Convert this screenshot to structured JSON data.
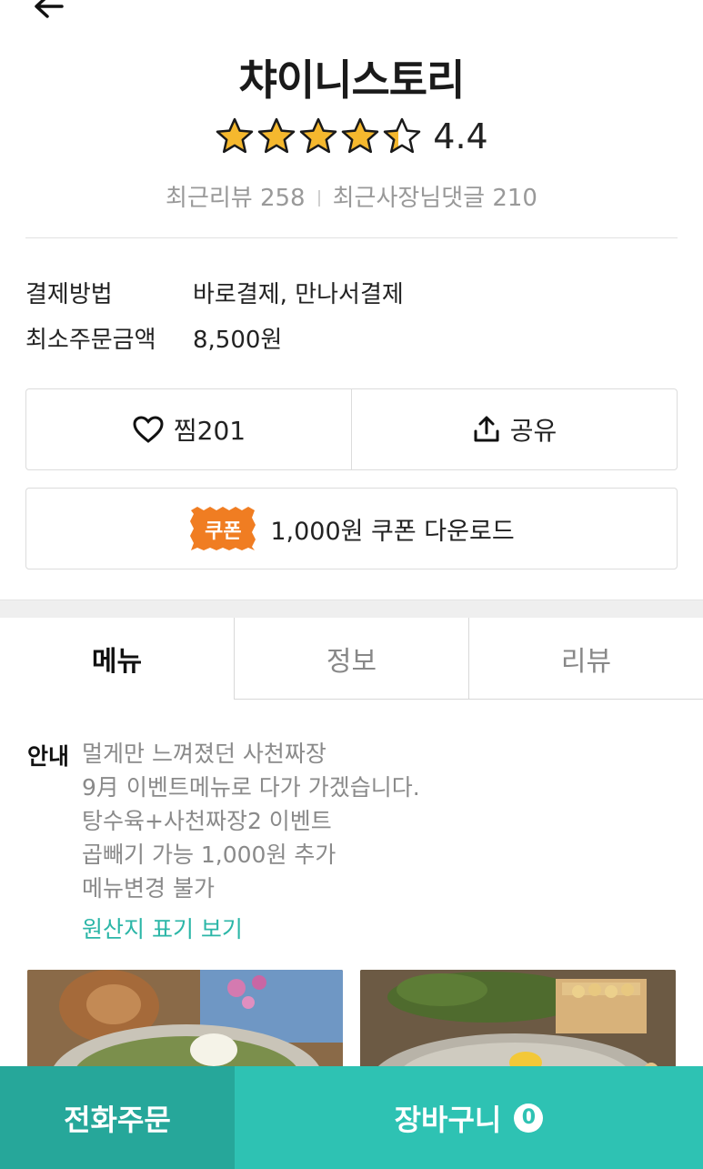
{
  "header": {
    "store_name": "챠이니스토리",
    "rating": "4.4",
    "stars_filled": 4.4,
    "review_label": "최근리뷰 258",
    "owner_reply_label": "최근사장님댓글 210"
  },
  "info": {
    "payment_key": "결제방법",
    "payment_value": "바로결제, 만나서결제",
    "min_order_key": "최소주문금액",
    "min_order_value": "8,500원"
  },
  "actions": {
    "like_label": "찜201",
    "share_label": "공유",
    "coupon_badge": "쿠폰",
    "coupon_label": "1,000원 쿠폰 다운로드"
  },
  "tabs": [
    {
      "label": "메뉴",
      "active": true
    },
    {
      "label": "정보",
      "active": false
    },
    {
      "label": "리뷰",
      "active": false
    }
  ],
  "notice": {
    "label": "안내",
    "lines": [
      "멀게만 느껴졌던 사천짜장",
      "9月 이벤트메뉴로 다가 가겠습니다.",
      "탕수육+사천짜장2 이벤트",
      "곱빼기 가능 1,000원 추가",
      "메뉴변경 불가"
    ],
    "origin_link": "원산지 표기 보기"
  },
  "bottom": {
    "phone_order": "전화주문",
    "cart": "장바구니",
    "cart_count": "0"
  },
  "colors": {
    "accent": "#2ec2b3",
    "accent_dark": "#26a79a",
    "star": "#f5b82e",
    "coupon": "#f07d22"
  }
}
